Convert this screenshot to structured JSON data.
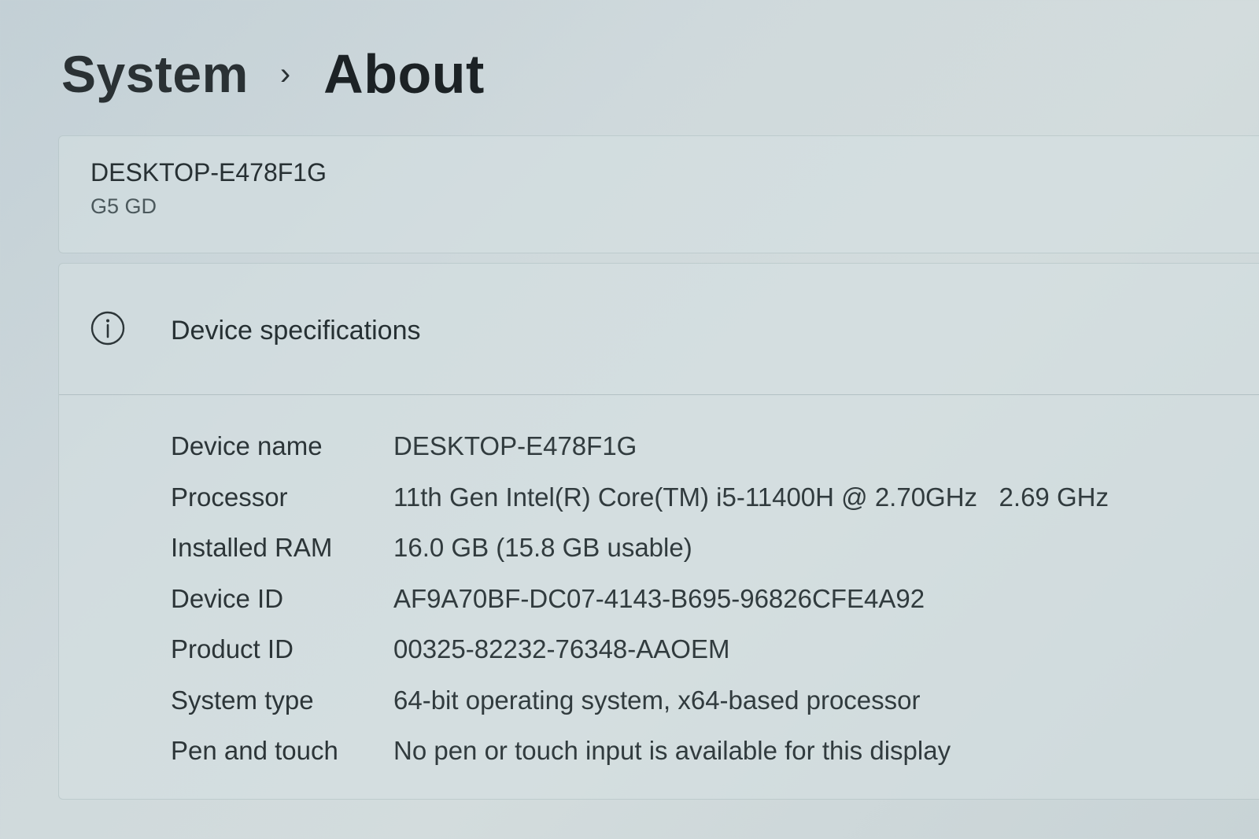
{
  "header": {
    "breadcrumb_parent": "System",
    "breadcrumb_separator": "›",
    "breadcrumb_current": "About"
  },
  "device": {
    "hostname": "DESKTOP-E478F1G",
    "model": "G5 GD"
  },
  "specs": {
    "icon": "info-circle-icon",
    "title": "Device specifications",
    "rows": [
      {
        "label": "Device name",
        "value": "DESKTOP-E478F1G"
      },
      {
        "label": "Processor",
        "value": "11th Gen Intel(R) Core(TM) i5-11400H @ 2.70GHz   2.69 GHz"
      },
      {
        "label": "Installed RAM",
        "value": "16.0 GB (15.8 GB usable)"
      },
      {
        "label": "Device ID",
        "value": "AF9A70BF-DC07-4143-B695-96826CFE4A92"
      },
      {
        "label": "Product ID",
        "value": "00325-82232-76348-AAOEM"
      },
      {
        "label": "System type",
        "value": "64-bit operating system, x64-based processor"
      },
      {
        "label": "Pen and touch",
        "value": "No pen or touch input is available for this display"
      }
    ]
  },
  "colors": {
    "background": "#cfd9dc",
    "card": "#d6e0e2",
    "text": "#1f2628"
  }
}
